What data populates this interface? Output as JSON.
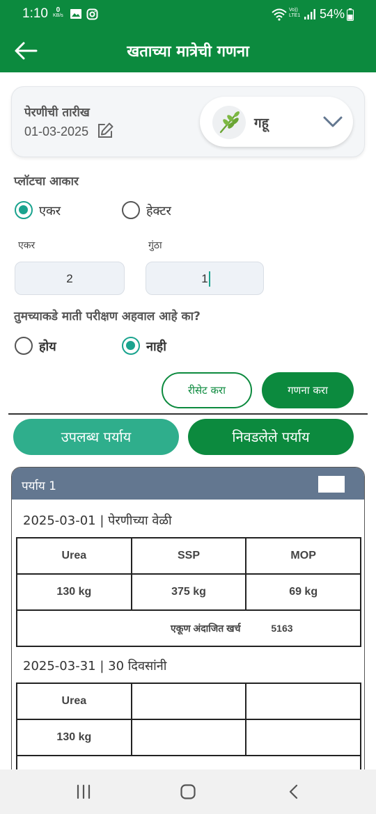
{
  "status_bar": {
    "time": "1:10",
    "speed_value": "0",
    "speed_unit": "KB/s",
    "network_top": "Vo))",
    "network_bottom": "LTE1",
    "battery": "54%"
  },
  "app_bar": {
    "title": "खताच्या मात्रेची गणना",
    "back_icon": "arrow-left-icon"
  },
  "sowing": {
    "label": "पेरणीची तारीख",
    "date": "01-03-2025",
    "crop": "गहू"
  },
  "plot": {
    "label": "प्लॉटचा आकार",
    "options": [
      {
        "label": "एकर",
        "checked": true
      },
      {
        "label": "हेक्टर",
        "checked": false
      }
    ],
    "acre_label": "एकर",
    "guntha_label": "गुंठा",
    "acre_value": "2",
    "guntha_value": "1"
  },
  "soil_test": {
    "question": "तुमच्याकडे माती परीक्षण अहवाल आहे का?",
    "options": [
      {
        "label": "होय",
        "checked": false
      },
      {
        "label": "नाही",
        "checked": true
      }
    ]
  },
  "actions": {
    "reset": "रीसेट करा",
    "calculate": "गणना करा"
  },
  "tabs": {
    "available": "उपलब्ध पर्याय",
    "selected": "निवडलेले पर्याय"
  },
  "option": {
    "title": "पर्याय 1",
    "schedules": [
      {
        "heading": "2025-03-01 | पेरणीच्या वेळी",
        "headers": [
          "Urea",
          "SSP",
          "MOP"
        ],
        "values": [
          "130 kg",
          "375 kg",
          "69 kg"
        ],
        "total_label": "एकूण अंदाजित खर्च",
        "total_value": "5163"
      },
      {
        "heading": "2025-03-31 | 30 दिवसांनी",
        "headers": [
          "Urea",
          "",
          ""
        ],
        "values": [
          "130 kg",
          "",
          ""
        ]
      }
    ]
  },
  "colors": {
    "primary": "#0c8a3e",
    "accent": "#1aa38e",
    "tab_available": "#2fae8c",
    "option_header": "#637790"
  }
}
